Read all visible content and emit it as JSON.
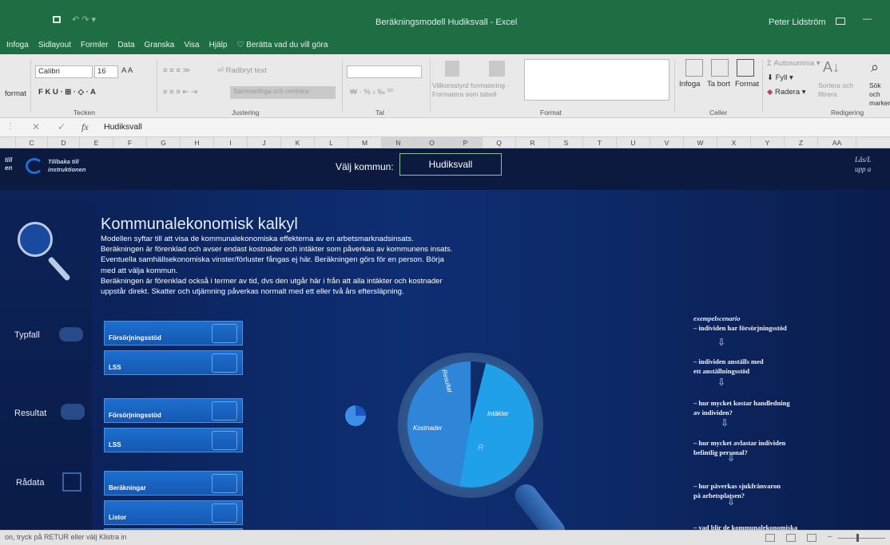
{
  "window": {
    "title": "Beräkningsmodell Hudiksvall  -  Excel",
    "user": "Peter Lidström"
  },
  "tabs": [
    "Infoga",
    "Sidlayout",
    "Formler",
    "Data",
    "Granska",
    "Visa",
    "Hjälp"
  ],
  "tell_me": "Berätta vad du vill göra",
  "ribbon": {
    "font_name": "Calibri",
    "font_size": "16",
    "wrap_text": "Radbryt text",
    "merge_center": "Sammanfoga och centrera",
    "format_label": "format",
    "group_font": "Tecken",
    "group_alignment": "Justering",
    "group_number": "Tal",
    "cond_format": "Villkorsstyrd formatering",
    "format_table": "Formatera som tabell",
    "group_styles": "Format",
    "insert": "Infoga",
    "delete": "Ta bort",
    "format": "Format",
    "group_cells": "Celler",
    "autosum": "Autosumma",
    "fill": "Fyll",
    "clear": "Radera",
    "sort_filter": "Sortera och filtrera",
    "find": "Sök och markera",
    "group_editing": "Redigering"
  },
  "formula_bar": {
    "fx": "fx",
    "value": "Hudiksvall"
  },
  "columns": [
    "C",
    "D",
    "E",
    "F",
    "G",
    "H",
    "I",
    "J",
    "K",
    "L",
    "M",
    "N",
    "O",
    "P",
    "Q",
    "R",
    "S",
    "T",
    "U",
    "V",
    "W",
    "X",
    "Y",
    "Z",
    "AA"
  ],
  "sheet": {
    "back_link": "Tillbaka till instruktionen",
    "left_cut": "till",
    "left_cut2": "en",
    "right_cut": "Lås/L",
    "right_cut2": "upp a",
    "select_label": "Välj kommun:",
    "select_value": "Hudiksvall",
    "title": "Kommunalekonomisk kalkyl",
    "para1": "Modellen syftar till att visa de kommunalekonomiska effekterna av en arbetsmarknadsinsats.",
    "para2": "Beräkningen är förenklad och avser endast kostnader och intäkter som påverkas av kommunens insats.",
    "para3": "Eventuella samhällsekonomiska vinster/förluster fångas ej här. Beräkningen görs för en person. Börja",
    "para4": "med att välja kommun.",
    "para5": "Beräkningen är förenklad också i termer av tid, dvs den utgår här i från att alla intäkter och kostnader",
    "para6": "uppstår direkt. Skatter och utjämning påverkas normalt med ett eller två års eftersläpning.",
    "nav": {
      "typfall": "Typfall",
      "resultat": "Resultat",
      "radata": "Rådata"
    },
    "buttons": {
      "typ_forsorj": "Försörjningsstöd",
      "typ_lss": "LSS",
      "res_forsorj": "Försörjningsstöd",
      "res_lss": "LSS",
      "berakningar": "Beräkningar",
      "listor": "Listor"
    },
    "pie": {
      "resultat": "Resultat",
      "kostnader": "Kostnader",
      "intakter": "Intäkter",
      "r": "R"
    },
    "scenario": {
      "heading": "exempelscenario",
      "s1": "– individen har försörjningsstöd",
      "s2a": "– individen anställs med",
      "s2b": "ett anställningsstöd",
      "s3a": "– hur mycket kostar handledning",
      "s3b": "av individen?",
      "s4a": "– hur mycket avlastar individen",
      "s4b": "befintlig personal?",
      "s5a": "– hur påverkas sjukfrånvaron",
      "s5b": "på arbetsplatsen?",
      "s6": "– vad blir de kommunalekonomiska"
    }
  },
  "status": {
    "text": "on, tryck på RETUR eller välj Klistra in"
  }
}
